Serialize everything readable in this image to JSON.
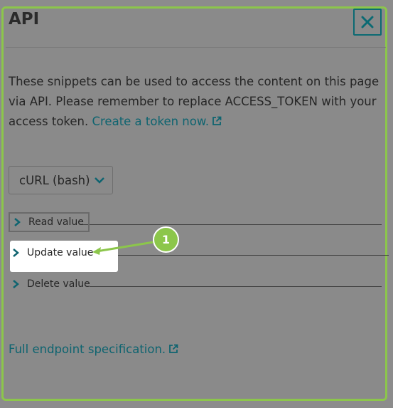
{
  "dialog": {
    "title": "API",
    "close_icon": "close-icon"
  },
  "description": {
    "text": "These snippets can be used to access the content on this page via API. Please remember to replace ACCESS_TOKEN with your access token.",
    "link_label": "Create a token now."
  },
  "language_select": {
    "selected": "cURL (bash)"
  },
  "snippets": [
    {
      "label": "Read value"
    },
    {
      "label": "Update value"
    },
    {
      "label": "Delete value"
    }
  ],
  "callout": {
    "number": "1"
  },
  "footer": {
    "link_label": "Full endpoint specification."
  },
  "colors": {
    "accent": "#0e6470",
    "highlight_green": "#8cc64b"
  }
}
